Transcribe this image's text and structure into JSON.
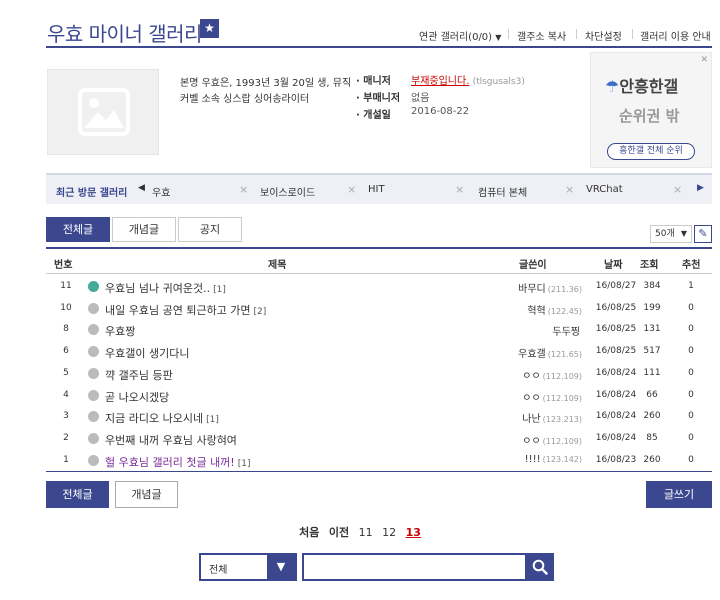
{
  "header": {
    "title": "우효 마이너 갤러리",
    "badge_icon": "bookmark-star-icon",
    "menu": [
      "연관 갤러리(0/0)",
      "갤주소 복사",
      "차단설정",
      "갤러리 이용 안내"
    ]
  },
  "gallery_info": {
    "desc_line1": "본명 우효은, 1993년 3월 20일 생, 뮤직",
    "desc_line2": "커벨 소속 싱스랍 싱어송라이터",
    "manager_label": "매니저",
    "manager_value": "부재중입니다.",
    "manager_id": "(tlsgusals3)",
    "submanager_label": "부매니저",
    "submanager_value": "없음",
    "opened_label": "개설일",
    "opened_value": "2016-08-22"
  },
  "ad": {
    "logo": "안흥한갤",
    "sub": "순위권 밖",
    "button": "흥한갤 전체 순위"
  },
  "recent": {
    "label": "최근 방문 갤러리",
    "items": [
      "우효",
      "보이스로이드",
      "HIT",
      "컴퓨터 본체",
      "VRChat"
    ]
  },
  "tabs": [
    "전체글",
    "개념글",
    "공지"
  ],
  "per_page": "50개",
  "table": {
    "headers": [
      "번호",
      "제목",
      "글쓴이",
      "날짜",
      "조회",
      "추천"
    ],
    "rows": [
      {
        "num": "11",
        "title": "우효님 넘나 귀여운것..",
        "cmt": "[1]",
        "writer": "바무디",
        "ip": "(211.36)",
        "date": "16/08/27",
        "views": "384",
        "rec": "1",
        "recommended": true
      },
      {
        "num": "10",
        "title": "내일 우효님 공연 퇴근하고 가면",
        "cmt": "[2]",
        "writer": "혁혁",
        "ip": "(122.45)",
        "date": "16/08/25",
        "views": "199",
        "rec": "0"
      },
      {
        "num": "8",
        "title": "우효짱",
        "cmt": "",
        "writer": "두두찡",
        "ip": "",
        "date": "16/08/25",
        "views": "131",
        "rec": "0"
      },
      {
        "num": "6",
        "title": "우효갤이 생기다니",
        "cmt": "",
        "writer": "우효갤",
        "ip": "(121.65)",
        "date": "16/08/25",
        "views": "517",
        "rec": "0"
      },
      {
        "num": "5",
        "title": "꺅 갤주님 등판",
        "cmt": "",
        "writer": "ㅇㅇ",
        "ip": "(112.109)",
        "date": "16/08/24",
        "views": "111",
        "rec": "0"
      },
      {
        "num": "4",
        "title": "곧 나오시겠당",
        "cmt": "",
        "writer": "ㅇㅇ",
        "ip": "(112.109)",
        "date": "16/08/24",
        "views": "66",
        "rec": "0"
      },
      {
        "num": "3",
        "title": "지금 라디오 나오시네",
        "cmt": "[1]",
        "writer": "나난",
        "ip": "(123.213)",
        "date": "16/08/24",
        "views": "260",
        "rec": "0"
      },
      {
        "num": "2",
        "title": "우번째 내꺼 우효님 사랑혀여",
        "cmt": "",
        "writer": "ㅇㅇ",
        "ip": "(112.109)",
        "date": "16/08/24",
        "views": "85",
        "rec": "0"
      },
      {
        "num": "1",
        "title": "헐 우효님 갤러리 첫글 내꺼!",
        "cmt": "[1]",
        "writer": "!!!!",
        "ip": "(123.142)",
        "date": "16/08/23",
        "views": "260",
        "rec": "0",
        "highlight": true
      }
    ]
  },
  "bottom_buttons": {
    "all": "전체글",
    "concept": "개념글",
    "write": "글쓰기"
  },
  "pager": {
    "first": "처음",
    "prev": "이전",
    "pages": [
      "11",
      "12",
      "13"
    ],
    "current": "13"
  },
  "search": {
    "select": "전체",
    "placeholder": ""
  }
}
